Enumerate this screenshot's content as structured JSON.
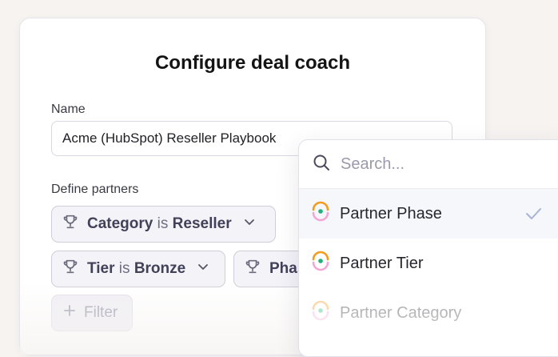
{
  "title": "Configure deal coach",
  "name_field": {
    "label": "Name",
    "value": "Acme (HubSpot) Reseller Playbook"
  },
  "partners": {
    "label": "Define partners",
    "chips": [
      {
        "field": "Category",
        "op": "is",
        "value": "Reseller"
      },
      {
        "field": "Tier",
        "op": "is",
        "value": "Bronze"
      },
      {
        "field": "Phas",
        "op": "",
        "value": ""
      }
    ],
    "add_filter_label": "Filter"
  },
  "dropdown": {
    "search_placeholder": "Search...",
    "options": [
      {
        "label": "Partner Phase",
        "selected": true
      },
      {
        "label": "Partner Tier",
        "selected": false
      },
      {
        "label": "Partner Category",
        "selected": false
      }
    ]
  },
  "colors": {
    "accent_orange": "#f59a1b",
    "accent_pink": "#f3a6d6",
    "accent_green": "#22b07a",
    "check": "#a8b3d8"
  }
}
